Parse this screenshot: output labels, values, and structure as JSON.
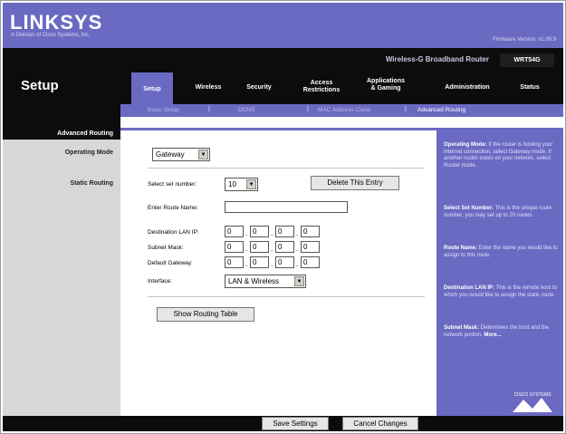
{
  "brand": {
    "logo": "LINKSYS",
    "tagline": "A Division of Cisco Systems, Inc.",
    "firmware": "Firmware Version: v1.00.9"
  },
  "product": {
    "name": "Wireless-G Broadband Router",
    "model": "WRT54G"
  },
  "page_title": "Setup",
  "tabs": [
    {
      "label": "Setup",
      "active": true
    },
    {
      "label": "Wireless"
    },
    {
      "label": "Security"
    },
    {
      "label": "Access\nRestrictions"
    },
    {
      "label": "Applications\n& Gaming"
    },
    {
      "label": "Administration"
    },
    {
      "label": "Status"
    }
  ],
  "subtabs": [
    {
      "label": "Basic Setup"
    },
    {
      "label": "DDNS"
    },
    {
      "label": "MAC Address Clone"
    },
    {
      "label": "Advanced Routing",
      "active": true
    }
  ],
  "section": {
    "title": "Advanced Routing",
    "operating_mode_label": "Operating Mode",
    "static_routing_label": "Static Routing"
  },
  "form": {
    "operating_mode": "Gateway",
    "select_set_number_label": "Select set number:",
    "set_number": "10",
    "delete_button": "Delete This Entry",
    "route_name_label": "Enter Route Name:",
    "route_name": "",
    "dest_ip_label": "Destination LAN IP:",
    "dest_ip": [
      "0",
      "0",
      "0",
      "0"
    ],
    "subnet_label": "Subnet Mask:",
    "subnet": [
      "0",
      "0",
      "0",
      "0"
    ],
    "gateway_label": "Default Gateway:",
    "gateway": [
      "0",
      "0",
      "0",
      "0"
    ],
    "interface_label": "Interface:",
    "interface": "LAN & Wireless",
    "show_table_button": "Show Routing Table"
  },
  "help": {
    "p1_title": "Operating Mode:",
    "p1_text": "If the router is hosting your Internet connection, select Gateway mode. If another router exists on your network, select Router mode.",
    "p2_title": "Select Set Number:",
    "p2_text": "This is the unique route number, you may set up to 20 routes.",
    "p3_title": "Route Name:",
    "p3_text": "Enter the name you would like to assign to this route.",
    "p4_title": "Destination LAN IP:",
    "p4_text": "This is the remote host to which you would like to assign the static route.",
    "p5_title": "Subnet Mask:",
    "p5_text": "Determines the host and the network portion.",
    "more": "More...",
    "cisco": "CISCO SYSTEMS"
  },
  "footer": {
    "save": "Save Settings",
    "cancel": "Cancel Changes"
  },
  "colors": {
    "accent": "#6a6ac2",
    "dark": "#0c0c0c",
    "label_bg": "#d7d7d7"
  }
}
